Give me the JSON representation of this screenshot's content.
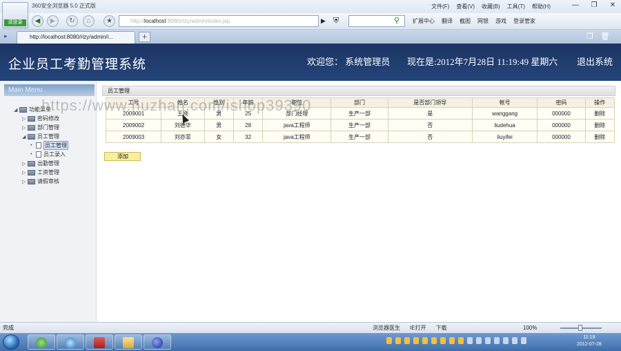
{
  "browser": {
    "title": "360安全浏览器 5.0 正式版",
    "logo_tag": "请登录",
    "menu": [
      "文件(F)",
      "查看(V)",
      "收藏(B)",
      "工具(T)",
      "帮助(H)"
    ],
    "address_prefix": "http://",
    "address_host": "localhost",
    "address_rest": ":8080/rlzy/admin/index.jsp",
    "toolbar_right": [
      "扩展中心",
      "翻译",
      "截图",
      "网银",
      "游戏",
      "登录管家"
    ],
    "tab_title": "http://localhost:8080/rlzy/admin/i..."
  },
  "header": {
    "system_title": "企业员工考勤管理系统",
    "welcome": "欢迎您：  系统管理员",
    "clock": "现在是:2012年7月28日  11:19:49 星期六",
    "logout": "退出系统"
  },
  "sidebar": {
    "head": "Main Menu",
    "items": [
      {
        "label": "功能菜单",
        "level": 0,
        "toggle": "◢",
        "kind": "folder"
      },
      {
        "label": "密码修改",
        "level": 1,
        "toggle": "▷",
        "kind": "folder"
      },
      {
        "label": "部门管理",
        "level": 1,
        "toggle": "▷",
        "kind": "folder"
      },
      {
        "label": "员工管理",
        "level": 1,
        "toggle": "◢",
        "kind": "folder"
      },
      {
        "label": "员工管理",
        "level": 2,
        "toggle": "•",
        "kind": "page",
        "selected": true
      },
      {
        "label": "员工录入",
        "level": 2,
        "toggle": "•",
        "kind": "page"
      },
      {
        "label": "出勤管理",
        "level": 1,
        "toggle": "▷",
        "kind": "folder"
      },
      {
        "label": "工资管理",
        "level": 1,
        "toggle": "▷",
        "kind": "folder"
      },
      {
        "label": "请假审核",
        "level": 1,
        "toggle": "▷",
        "kind": "folder"
      }
    ]
  },
  "main": {
    "panel_title": "员工管理",
    "columns": [
      "工号",
      "姓名",
      "性别",
      "年龄",
      "职位",
      "部门",
      "是否部门领导",
      "帐号",
      "密码",
      "操作"
    ],
    "rows": [
      [
        "2009001",
        "王刚",
        "男",
        "25",
        "部门经理",
        "生产一部",
        "是",
        "wanggang",
        "000000",
        "删除"
      ],
      [
        "2009002",
        "刘德华",
        "男",
        "28",
        "java工程师",
        "生产一部",
        "否",
        "liudehua",
        "000000",
        "删除"
      ],
      [
        "2009003",
        "刘亦菲",
        "女",
        "32",
        "java工程师",
        "生产一部",
        "否",
        "liuyifei",
        "000000",
        "删除"
      ]
    ],
    "add_button": "添加"
  },
  "watermark": "https://www.huzhan.com/ishop39390",
  "statusbar": {
    "left": "完成",
    "items": [
      "浏览器医生",
      "IE打开",
      "下载"
    ],
    "zoom": "100%"
  },
  "taskbar": {
    "time": "11:19",
    "date": "2012-07-28"
  },
  "colors": {
    "header_bg": "#1c3563",
    "table_header_bg": "#f4f0e4",
    "add_button_bg": "#f7ef9c"
  }
}
